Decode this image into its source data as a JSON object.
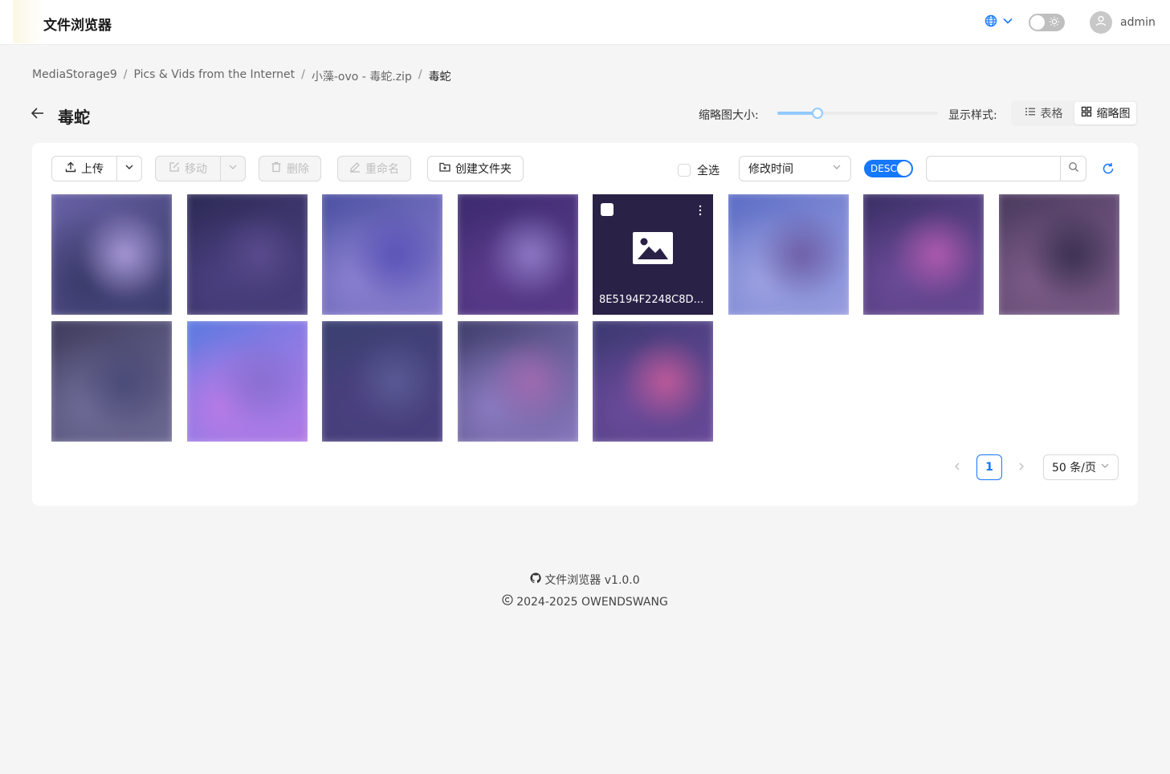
{
  "header": {
    "app_title": "文件浏览器",
    "username": "admin",
    "icons": [
      "globe-icon",
      "chevron-down-icon",
      "sun-icon",
      "user-icon"
    ]
  },
  "breadcrumb": [
    {
      "label": "MediaStorage9"
    },
    {
      "label": "Pics & Vids from the Internet"
    },
    {
      "label": "小藻-ovo - 毒蛇.zip"
    },
    {
      "label": "毒蛇"
    }
  ],
  "title_row": {
    "title": "毒蛇",
    "thumb_size_label": "缩略图大小:",
    "thumb_size_value": 0.25,
    "style_label": "显示样式:",
    "style_options": [
      "表格",
      "缩略图"
    ],
    "style_selected": "缩略图"
  },
  "toolbar": {
    "upload": "上传",
    "move": "移动",
    "delete": "删除",
    "rename": "重命名",
    "create_folder": "创建文件夹",
    "select_all": "全选",
    "sort_by": "修改时间",
    "order": "DESC",
    "search_placeholder": ""
  },
  "files": [
    {
      "name": "",
      "colors": [
        "#6a63a8",
        "#3a3a6a",
        "#a99ad8"
      ]
    },
    {
      "name": "",
      "colors": [
        "#2c2a55",
        "#4a3f7f",
        "#5a4b8e"
      ]
    },
    {
      "name": "",
      "colors": [
        "#4b50a0",
        "#8a7fd0",
        "#5b53b8"
      ]
    },
    {
      "name": "",
      "colors": [
        "#3b2a6e",
        "#5a3a8a",
        "#8f7ac6"
      ]
    },
    {
      "name": "8E5194F2248C8D18...",
      "colors": [
        "#2a2147"
      ],
      "active": true
    },
    {
      "name": "",
      "colors": [
        "#5a6bc4",
        "#9ba0e0",
        "#6e5ea6"
      ]
    },
    {
      "name": "",
      "colors": [
        "#3a2f66",
        "#6a4a96",
        "#b05ab0"
      ]
    },
    {
      "name": "",
      "colors": [
        "#4a3a5e",
        "#7a5a86",
        "#3a3050"
      ]
    },
    {
      "name": "",
      "colors": [
        "#3e3b5c",
        "#6d6a96",
        "#4a4a78"
      ]
    },
    {
      "name": "",
      "colors": [
        "#5a7ae0",
        "#b77ae6",
        "#8a6ed0"
      ]
    },
    {
      "name": "",
      "colors": [
        "#3a4070",
        "#4a3f7f",
        "#5a5a96"
      ]
    },
    {
      "name": "",
      "colors": [
        "#3e3d6a",
        "#8a7ac0",
        "#a06ab0"
      ]
    },
    {
      "name": "",
      "colors": [
        "#3a3870",
        "#6a4a9a",
        "#c05a9a"
      ]
    }
  ],
  "pagination": {
    "current_page": "1",
    "page_size": "50 条/页"
  },
  "footer": {
    "line1": "文件浏览器 v1.0.0",
    "line2": "2024-2025 OWENDSWANG"
  },
  "colors": {
    "accent": "#1677ff",
    "slider": "#91caff"
  }
}
